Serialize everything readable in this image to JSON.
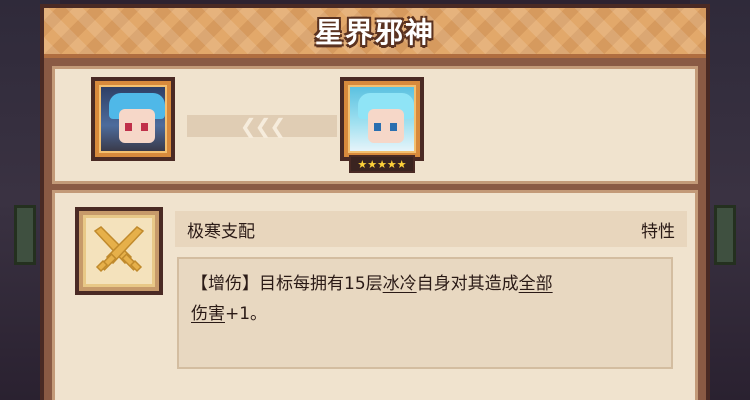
{
  "dialog": {
    "title": "星界邪神"
  },
  "evolution": {
    "from_character": "blue-haired-character-portrait",
    "to_character": "ice-haired-character-portrait",
    "arrow_glyphs": "❮❮❮",
    "target_star_rating": 5,
    "star_glyphs": "★★★★★"
  },
  "trait": {
    "icon": "crossed-swords-icon",
    "name": "极寒支配",
    "type": "特性",
    "description": {
      "part1": "【增伤】目标每拥有15层",
      "link1": "冰冷",
      "part2": "自身对其造成",
      "link2a": "全部",
      "link2b": "伤害",
      "part3": "+1。"
    }
  },
  "colors": {
    "header": "#e2a86a",
    "panel_border": "#4a2a24",
    "content_bg": "#f0e3ce",
    "star": "#ffd23a"
  }
}
